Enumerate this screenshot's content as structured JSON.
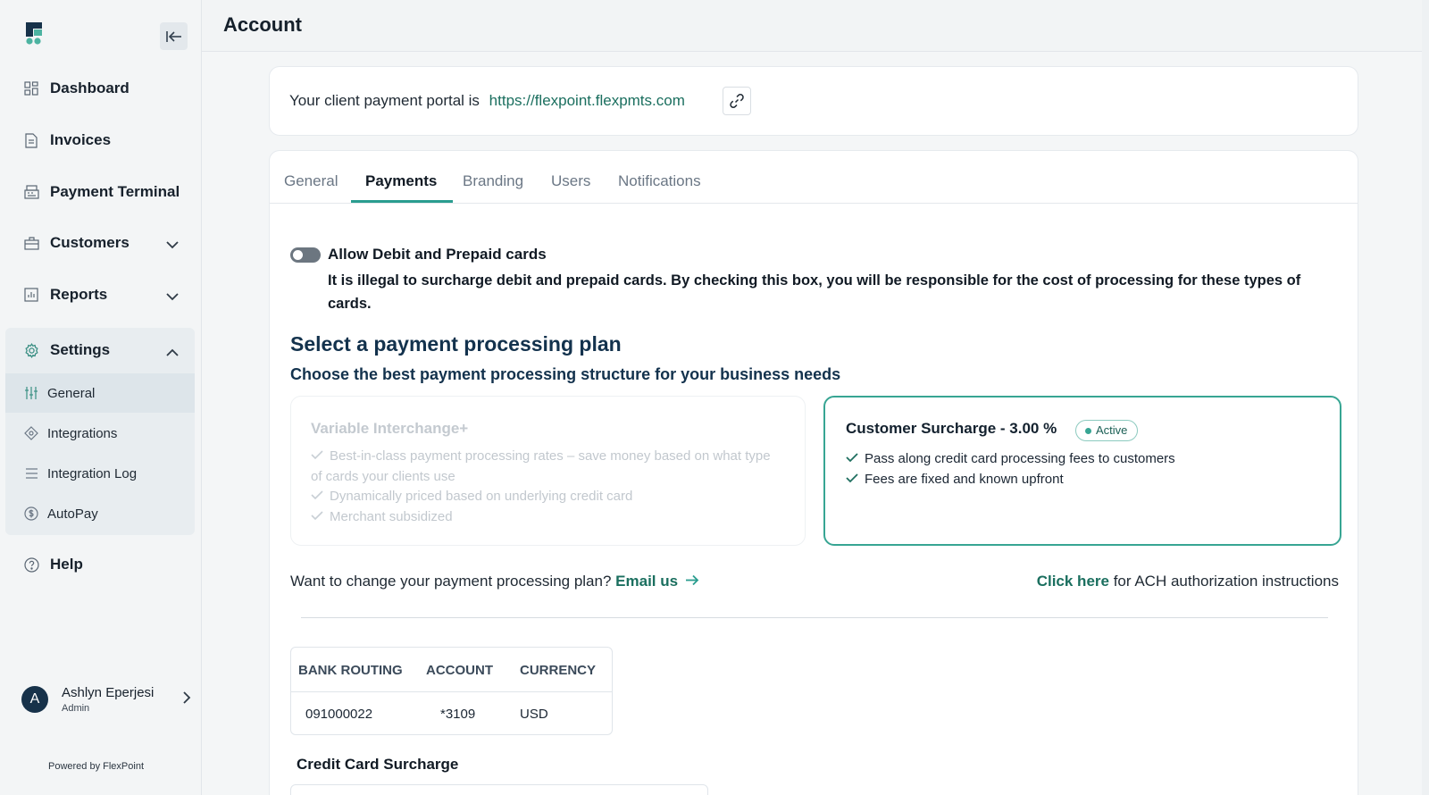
{
  "sidebar": {
    "nav": [
      {
        "label": "Dashboard",
        "icon": "dashboard-icon"
      },
      {
        "label": "Invoices",
        "icon": "invoice-icon"
      },
      {
        "label": "Payment Terminal",
        "icon": "terminal-icon"
      },
      {
        "label": "Customers",
        "icon": "customers-icon"
      },
      {
        "label": "Reports",
        "icon": "reports-icon"
      },
      {
        "label": "Settings",
        "icon": "gear-icon"
      },
      {
        "label": "Help",
        "icon": "help-icon"
      }
    ],
    "settings_sub": [
      {
        "label": "General",
        "icon": "sliders-icon",
        "active": true
      },
      {
        "label": "Integrations",
        "icon": "integrations-icon"
      },
      {
        "label": "Integration Log",
        "icon": "list-icon"
      },
      {
        "label": "AutoPay",
        "icon": "dollar-icon"
      }
    ],
    "user": {
      "initial": "A",
      "name": "Ashlyn Eperjesi",
      "role": "Admin"
    },
    "powered_by": "Powered by FlexPoint"
  },
  "header": {
    "title": "Account"
  },
  "portal": {
    "prefix": "Your client payment portal is",
    "url": "https://flexpoint.flexpmts.com"
  },
  "tabs": [
    "General",
    "Payments",
    "Branding",
    "Users",
    "Notifications"
  ],
  "active_tab": "Payments",
  "debit_toggle": {
    "title": "Allow Debit and Prepaid cards",
    "description": "It is illegal to surcharge debit and prepaid cards. By checking this box, you will be responsible for the cost of processing for these types of cards.",
    "enabled": false
  },
  "plans": {
    "heading": "Select a payment processing plan",
    "subheading": "Choose the best payment processing structure for your business needs",
    "variable": {
      "title": "Variable Interchange+",
      "features": [
        "Best-in-class payment processing rates – save money based on what type of cards your clients use",
        "Dynamically priced based on underlying credit card",
        "Merchant subsidized"
      ]
    },
    "surcharge": {
      "title": "Customer Surcharge - 3.00 %",
      "badge": "Active",
      "features": [
        "Pass along credit card processing fees to customers",
        "Fees are fixed and known upfront"
      ]
    }
  },
  "change_plan": {
    "text": "Want to change your payment processing plan?",
    "link": "Email us"
  },
  "ach": {
    "link": "Click here",
    "text": "for ACH authorization instructions"
  },
  "bank": {
    "headers": [
      "BANK ROUTING",
      "ACCOUNT",
      "CURRENCY"
    ],
    "row": [
      "091000022",
      "*3109",
      "USD"
    ]
  },
  "credit_card_surcharge": {
    "title": "Credit Card Surcharge"
  },
  "colors": {
    "accent": "#2a9d8f",
    "link": "#1b6f5f",
    "heading": "#13324d"
  }
}
